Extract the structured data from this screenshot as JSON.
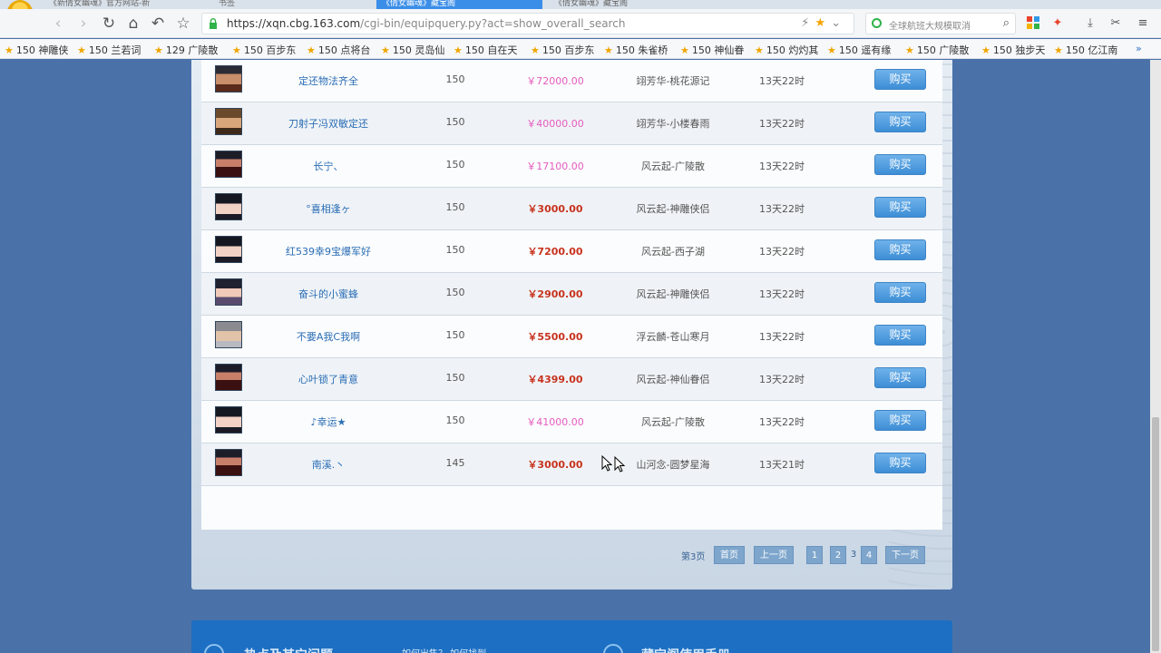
{
  "browser": {
    "tabs": [
      {
        "label": "《新倩女幽魂》官方网站-新"
      },
      {
        "label": "书签"
      },
      {
        "label": "《倩女幽魂》藏宝阁"
      },
      {
        "label": "《倩女幽魂》藏宝阁"
      }
    ],
    "url_host": "https://xqn.cbg.163.com",
    "url_path": "/cgi-bin/equipquery.py?act=show_overall_search",
    "search_placeholder": "全球航班大规模取消",
    "bookmarks": [
      "150 神雕侠",
      "150 兰若词",
      "129 广陵散",
      "150 百步东",
      "150 点将台",
      "150 灵岛仙",
      "150 自在天",
      "150 百步东",
      "150 朱雀桥",
      "150 神仙眷",
      "150 灼灼其",
      "150 遥有缘",
      "150 广陵散",
      "150 独步天",
      "150 亿江南"
    ],
    "bookmarks_more": "»"
  },
  "listing": {
    "buy_label": "购买",
    "rows": [
      {
        "name": "定还物法齐全",
        "level": "150",
        "price": "￥72000.00",
        "price_style": "pink",
        "server": "翊芳华-桃花源记",
        "time_left": "13天22时",
        "avatar": "male-a"
      },
      {
        "name": "刀射子冯双敏定还",
        "level": "150",
        "price": "￥40000.00",
        "price_style": "pink",
        "server": "翊芳华-小楼春雨",
        "time_left": "13天22时",
        "avatar": "male-b"
      },
      {
        "name": "长宁、",
        "level": "150",
        "price": "￥17100.00",
        "price_style": "pink",
        "server": "风云起-广陵散",
        "time_left": "13天22时",
        "avatar": "female-dark"
      },
      {
        "name": "°喜相逢ヶ",
        "level": "150",
        "price": "￥3000.00",
        "price_style": "red",
        "server": "风云起-神雕侠侣",
        "time_left": "13天22时",
        "avatar": "female-a"
      },
      {
        "name": "红539幸9宝爆军好",
        "level": "150",
        "price": "￥7200.00",
        "price_style": "red",
        "server": "风云起-西子湖",
        "time_left": "13天22时",
        "avatar": "female-a"
      },
      {
        "name": "奋斗的小蜜蜂",
        "level": "150",
        "price": "￥2900.00",
        "price_style": "red",
        "server": "风云起-神雕侠侣",
        "time_left": "13天22时",
        "avatar": "female-b"
      },
      {
        "name": "不要A我C我啊",
        "level": "150",
        "price": "￥5500.00",
        "price_style": "red",
        "server": "浮云麟-苍山寒月",
        "time_left": "13天22时",
        "avatar": "male-grey"
      },
      {
        "name": "心叶锁了青意",
        "level": "150",
        "price": "￥4399.00",
        "price_style": "red",
        "server": "风云起-神仙眷侣",
        "time_left": "13天22时",
        "avatar": "female-dark"
      },
      {
        "name": "♪幸运★",
        "level": "150",
        "price": "￥41000.00",
        "price_style": "pink",
        "server": "风云起-广陵散",
        "time_left": "13天22时",
        "avatar": "female-a"
      },
      {
        "name": "南溪.丶",
        "level": "145",
        "price": "￥3000.00",
        "price_style": "red",
        "server": "山河念-圆梦星海",
        "time_left": "13天21时",
        "avatar": "female-dark"
      }
    ]
  },
  "pager": {
    "current_label": "第3页",
    "first": "首页",
    "prev": "上一页",
    "pages": [
      "1",
      "2",
      "3",
      "4"
    ],
    "current_page": "3",
    "next": "下一页"
  },
  "footer": {
    "left_title": "热点及其它问题",
    "mid_text": "如何出售？ 如何找到…",
    "right_title": "藏宝阁使用手册"
  }
}
